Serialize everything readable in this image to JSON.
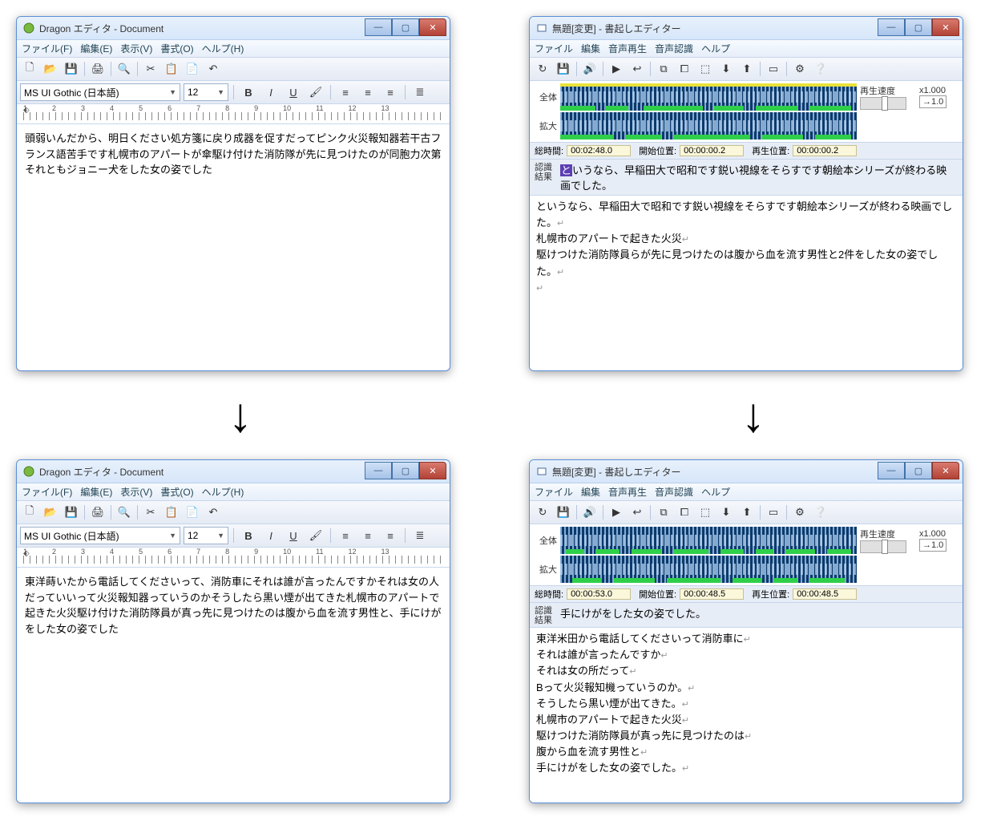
{
  "dragon": {
    "title": "Dragon エディタ - Document",
    "menu": [
      "ファイル(F)",
      "編集(E)",
      "表示(V)",
      "書式(O)",
      "ヘルプ(H)"
    ],
    "font_name": "MS UI Gothic (日本語)",
    "font_size": "12",
    "ruler_nums": [
      "1",
      "2",
      "3",
      "4",
      "5",
      "6",
      "7",
      "8",
      "9",
      "10",
      "11",
      "12",
      "13"
    ],
    "content_top": "頭弱いんだから、明日ください処方箋に戻り成器を促すだってピンク火災報知器若干古フランス語苦手です札幌市のアパートが傘駆け付けた消防隊が先に見つけたのが同胞力次第それともジョニー犬をした女の姿でした",
    "content_bottom": "東洋蒔いたから電話してくださいって、消防車にそれは誰が言ったんですかそれは女の人だっていいって火災報知器っていうのかそうしたら黒い煙が出てきた札幌市のアパートで起きた火災駆け付けた消防隊員が真っ先に見つけたのは腹から血を流す男性と、手にけがをした女の姿でした"
  },
  "kakiokoshi": {
    "title": "無題[変更] - 書起しエディター",
    "menu": [
      "ファイル",
      "編集",
      "音声再生",
      "音声認識",
      "ヘルプ"
    ],
    "speed_label": "再生速度",
    "speed_mult": "x1.000",
    "speed_reset": "→1.0",
    "row_labels": {
      "zentai": "全体",
      "kakudai": "拡大"
    },
    "status_labels": {
      "soujikan": "総時間:",
      "kaishi": "開始位置:",
      "saisei": "再生位置:"
    },
    "top": {
      "soujikan": "00:02:48.0",
      "kaishi": "00:00:00.2",
      "saisei": "00:00:00.2",
      "recog_label": "認識\n結果",
      "recog_text_hl": "と",
      "recog_text": "いうなら、早稲田大で昭和です鋭い視線をそらすです朝絵本シリーズが終わる映画でした。",
      "lines": [
        "というなら、早稲田大で昭和です鋭い視線をそらすです朝絵本シリーズが終わる映画でした。",
        "札幌市のアパートで起きた火災",
        "駆けつけた消防隊員らが先に見つけたのは腹から血を流す男性と2件をした女の姿でした。",
        ""
      ]
    },
    "bottom": {
      "soujikan": "00:00:53.0",
      "kaishi": "00:00:48.5",
      "saisei": "00:00:48.5",
      "recog_label": "認識\n結果",
      "recog_text": "手にけがをした女の姿でした。",
      "lines": [
        "東洋米田から電話してくださいって消防車に",
        "それは誰が言ったんですか",
        "それは女の所だって",
        "Bって火災報知機っていうのか。",
        "そうしたら黒い煙が出てきた。",
        "札幌市のアパートで起きた火災",
        "駆けつけた消防隊員が真っ先に見つけたのは",
        "腹から血を流す男性と",
        "手にけがをした女の姿でした。"
      ]
    }
  },
  "icons": {
    "new": "🗋",
    "open": "📂",
    "save": "💾",
    "print": "🖨",
    "find": "🔍",
    "cut": "✂",
    "copy": "📋",
    "paste": "📄",
    "undo": "↶",
    "bold": "B",
    "italic": "I",
    "underline": "U",
    "color": "🖌",
    "align_l": "≡",
    "align_c": "≡",
    "align_r": "≡",
    "list": "≣",
    "reload": "↻",
    "save2": "💾",
    "vol": "🔊",
    "play": "▶",
    "back": "↩",
    "mark1": "⧉",
    "mark2": "⧠",
    "mark3": "⬚",
    "down": "⬇",
    "up": "⬆",
    "card": "▭",
    "gear": "⚙",
    "help": "❔"
  }
}
